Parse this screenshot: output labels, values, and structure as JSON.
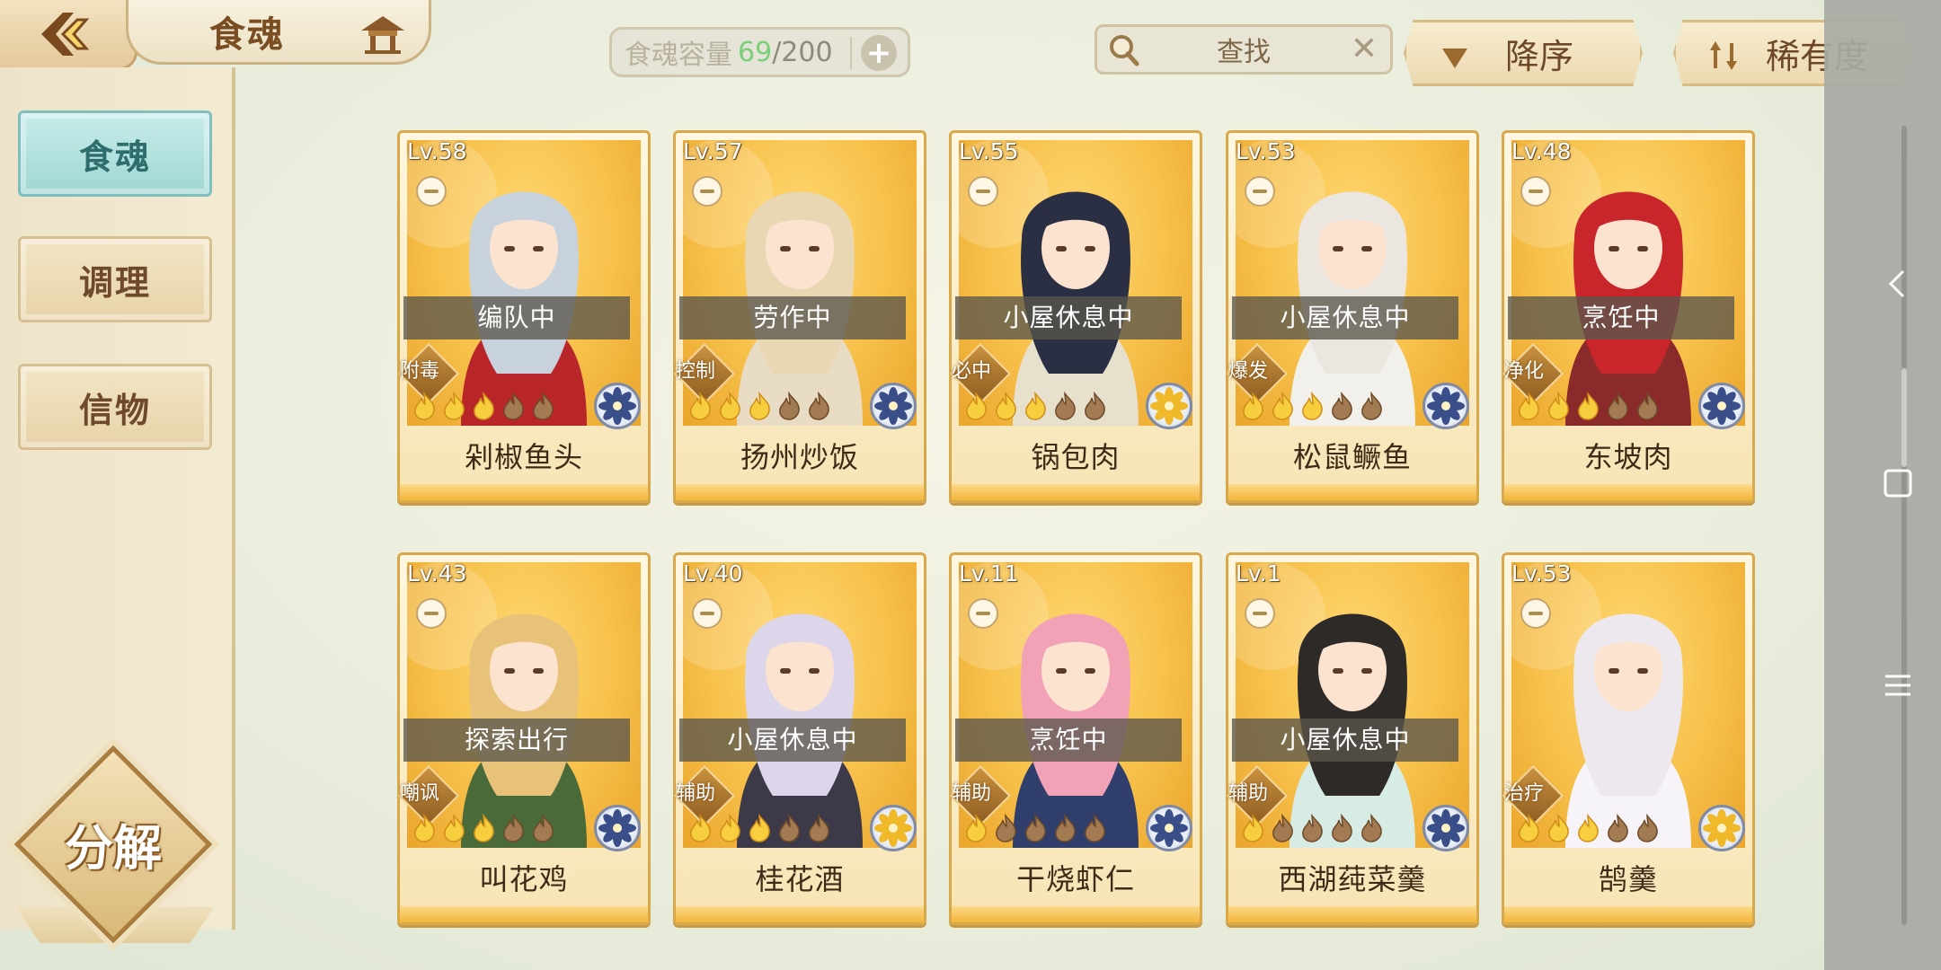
{
  "header": {
    "title": "食魂",
    "capacity_label": "食魂容量",
    "capacity_current": "69",
    "capacity_separator": "/",
    "capacity_max": "200",
    "capacity_plus": "+",
    "search_label": "查找",
    "search_clear": "✕",
    "sort_order_label": "降序",
    "sort_rarity_label": "稀有度"
  },
  "sidebar": {
    "items": [
      {
        "label": "食魂",
        "active": true
      },
      {
        "label": "调理",
        "active": false
      },
      {
        "label": "信物",
        "active": false
      }
    ],
    "decompose_label": "分解"
  },
  "colors": {
    "card_border": "#d9a84a",
    "portrait_bg": "#f7c04a",
    "active_tab": "#9fd6d3",
    "capacity_current": "#7ad07a"
  },
  "cards": [
    {
      "level": "Lv.58",
      "status": "编队中",
      "role": "附毒",
      "name": "剁椒鱼头",
      "stars_filled": 3,
      "stars_total": 5,
      "element": "blue-flower-icon"
    },
    {
      "level": "Lv.57",
      "status": "劳作中",
      "role": "控制",
      "name": "扬州炒饭",
      "stars_filled": 3,
      "stars_total": 5,
      "element": "blue-flower-icon"
    },
    {
      "level": "Lv.55",
      "status": "小屋休息中",
      "role": "必中",
      "name": "锅包肉",
      "stars_filled": 3,
      "stars_total": 5,
      "element": "gold-flower-icon"
    },
    {
      "level": "Lv.53",
      "status": "小屋休息中",
      "role": "爆发",
      "name": "松鼠鳜鱼",
      "stars_filled": 3,
      "stars_total": 5,
      "element": "blue-flower-icon"
    },
    {
      "level": "Lv.48",
      "status": "烹饪中",
      "role": "净化",
      "name": "东坡肉",
      "stars_filled": 3,
      "stars_total": 5,
      "element": "blue-flower-icon"
    },
    {
      "level": "Lv.43",
      "status": "探索出行",
      "role": "嘲讽",
      "name": "叫花鸡",
      "stars_filled": 3,
      "stars_total": 5,
      "element": "blue-flower-icon"
    },
    {
      "level": "Lv.40",
      "status": "小屋休息中",
      "role": "辅助",
      "name": "桂花酒",
      "stars_filled": 3,
      "stars_total": 5,
      "element": "gold-flower-icon"
    },
    {
      "level": "Lv.11",
      "status": "烹饪中",
      "role": "辅助",
      "name": "干烧虾仁",
      "stars_filled": 1,
      "stars_total": 5,
      "element": "blue-flower-icon"
    },
    {
      "level": "Lv.1",
      "status": "小屋休息中",
      "role": "辅助",
      "name": "西湖莼菜羹",
      "stars_filled": 1,
      "stars_total": 5,
      "element": "blue-flower-icon"
    },
    {
      "level": "Lv.53",
      "status": "",
      "role": "治疗",
      "name": "鹄羹",
      "stars_filled": 3,
      "stars_total": 5,
      "element": "gold-flower-icon"
    }
  ]
}
